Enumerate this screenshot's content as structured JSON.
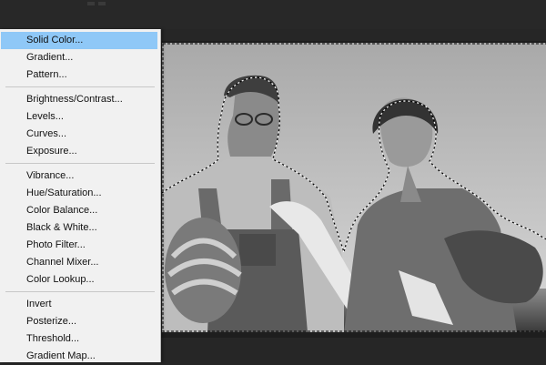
{
  "menu": {
    "groups": [
      [
        "Solid Color...",
        "Gradient...",
        "Pattern..."
      ],
      [
        "Brightness/Contrast...",
        "Levels...",
        "Curves...",
        "Exposure..."
      ],
      [
        "Vibrance...",
        "Hue/Saturation...",
        "Color Balance...",
        "Black & White...",
        "Photo Filter...",
        "Channel Mixer...",
        "Color Lookup..."
      ],
      [
        "Invert",
        "Posterize...",
        "Threshold...",
        "Gradient Map..."
      ]
    ],
    "active_item": "Solid Color..."
  },
  "colors": {
    "workspace_bg": "#262626",
    "menu_bg": "#f1f1f1",
    "menu_highlight": "#8fc8f7",
    "selection_outline": "#000000"
  }
}
